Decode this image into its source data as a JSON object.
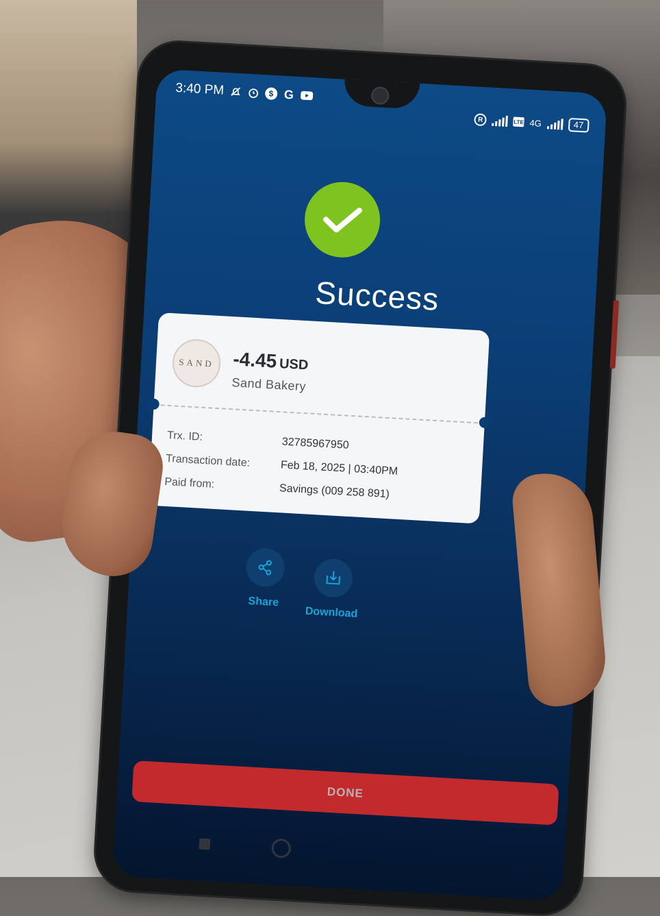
{
  "status_bar": {
    "time": "3:40 PM",
    "icons": [
      "mute-icon",
      "alarm-icon",
      "dollar-icon",
      "google-icon",
      "youtube-icon"
    ],
    "right_icons": [
      "registered-icon",
      "signal-icon",
      "volte-icon",
      "4g-signal-icon"
    ],
    "network": "4G",
    "battery": "47"
  },
  "header": {
    "title": "Success",
    "icon": "check-icon",
    "icon_color": "#7ec31f"
  },
  "receipt": {
    "merchant_logo_text": "SAND",
    "amount": "-4.45",
    "currency": "USD",
    "merchant": "Sand Bakery",
    "rows": [
      {
        "label": "Trx. ID:",
        "value": "32785967950"
      },
      {
        "label": "Transaction date:",
        "value": "Feb 18, 2025 | 03:40PM"
      },
      {
        "label": "Paid from:",
        "value": "Savings (009 258 891)"
      }
    ]
  },
  "actions": {
    "share_label": "Share",
    "download_label": "Download",
    "accent_color": "#1aa3d6"
  },
  "footer": {
    "done_label": "DONE",
    "done_color": "#c32a2e"
  }
}
